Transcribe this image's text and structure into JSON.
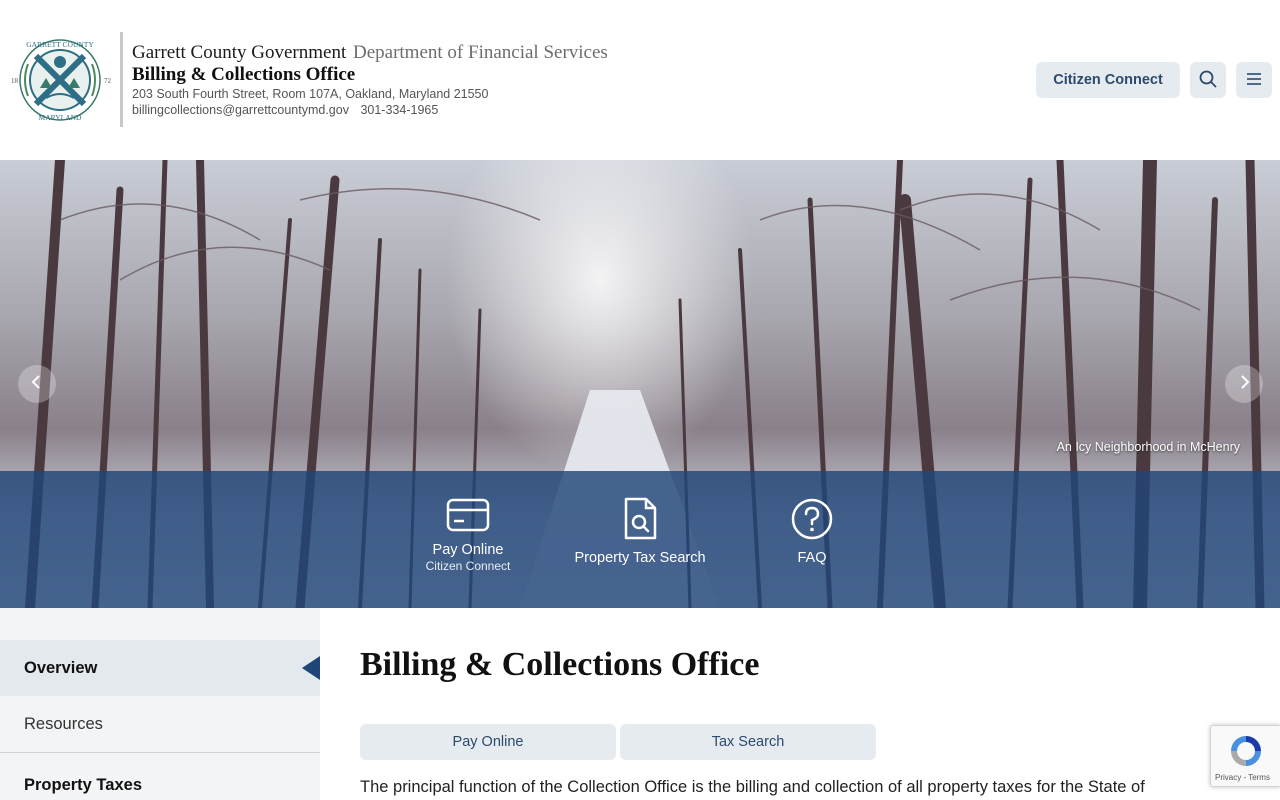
{
  "header": {
    "org_name": "Garrett County Government",
    "department": "Department of Financial Services",
    "office_name": "Billing & Collections Office",
    "address": "203 South Fourth Street, Room 107A, Oakland, Maryland 21550",
    "email": "billingcollections@garrettcountymd.gov",
    "phone": "301-334-1965",
    "seal": {
      "top_text": "GARRETT COUNTY",
      "bottom_text": "MARYLAND",
      "left_year": "18",
      "right_year": "72"
    },
    "citizen_connect_label": "Citizen Connect",
    "search_icon": "search-icon",
    "menu_icon": "hamburger-menu-icon"
  },
  "hero": {
    "caption": "An Icy Neighborhood in McHenry",
    "prev_icon": "arrow-left-icon",
    "next_icon": "arrow-right-icon",
    "quick_links": [
      {
        "label": "Pay Online",
        "sublabel": "Citizen Connect",
        "icon": "credit-card-icon"
      },
      {
        "label": "Property Tax Search",
        "sublabel": "",
        "icon": "document-search-icon"
      },
      {
        "label": "FAQ",
        "sublabel": "",
        "icon": "question-circle-icon"
      }
    ]
  },
  "sidebar": {
    "items": [
      {
        "label": "Overview",
        "active": true
      },
      {
        "label": "Resources",
        "active": false
      },
      {
        "label": "Property Taxes",
        "active": false
      }
    ]
  },
  "main": {
    "title": "Billing & Collections Office",
    "tabs": [
      {
        "label": "Pay Online"
      },
      {
        "label": "Tax Search"
      }
    ],
    "intro": "The principal function of the Collection Office is the billing and collection of all property taxes for the State of"
  },
  "recaptcha": {
    "links": "Privacy - Terms"
  },
  "colors": {
    "brand_blue": "#1f4677",
    "button_bg": "#e6ebef",
    "button_text": "#2b4a6e",
    "quickbar_bg": "#214678"
  }
}
